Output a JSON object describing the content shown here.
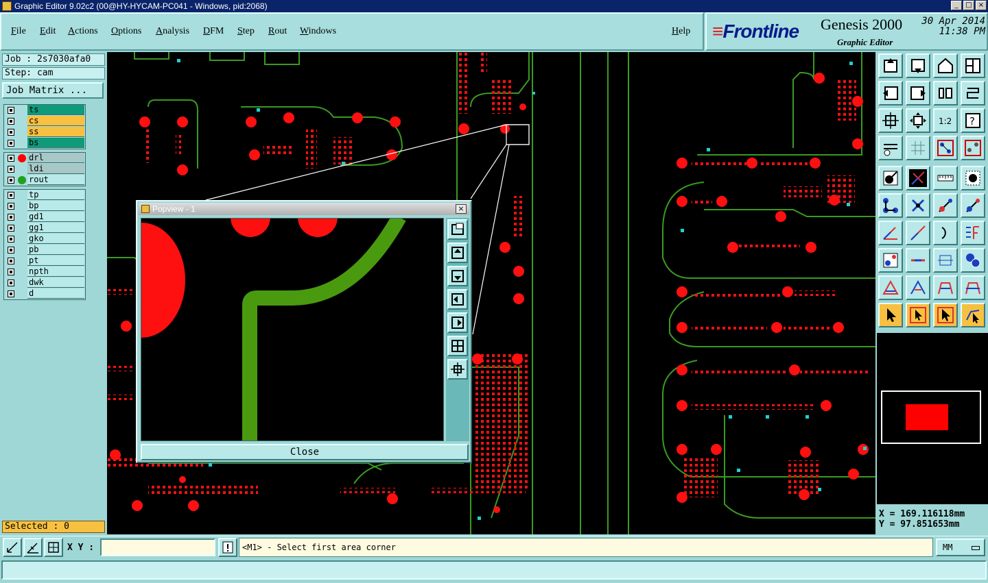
{
  "window": {
    "title": "Graphic Editor 9.02c2 (00@HY-HYCAM-PC041 - Windows, pid:2068)",
    "controls": [
      "_",
      "□",
      "×"
    ]
  },
  "menu": [
    "File",
    "Edit",
    "Actions",
    "Options",
    "Analysis",
    "DFM",
    "Step",
    "Rout",
    "Windows",
    "Help"
  ],
  "brand": {
    "logo": "Frontline",
    "product": "Genesis 2000",
    "subtitle": "Graphic Editor",
    "date": "30 Apr 2014",
    "time": "11:38 PM"
  },
  "job": {
    "job_label": "Job : 2s7030afa0",
    "step_label": "Step: cam",
    "matrix_button": "Job Matrix ..."
  },
  "layers": {
    "group1": [
      {
        "name": "ts",
        "style": "green"
      },
      {
        "name": "cs",
        "style": "orange"
      },
      {
        "name": "ss",
        "style": "orange"
      },
      {
        "name": "bs",
        "style": "green"
      }
    ],
    "group2": [
      {
        "name": "drl",
        "style": "gray",
        "dot": "#ff0000"
      },
      {
        "name": "ldi",
        "style": "gray",
        "dot": ""
      },
      {
        "name": "rout",
        "style": "plain",
        "dot": "#20a020"
      }
    ],
    "group3": [
      {
        "name": "tp"
      },
      {
        "name": "bp"
      },
      {
        "name": "gd1"
      },
      {
        "name": "gg1"
      },
      {
        "name": "gko"
      },
      {
        "name": "pb"
      },
      {
        "name": "pt"
      },
      {
        "name": "npth"
      },
      {
        "name": "dwk"
      },
      {
        "name": "d"
      }
    ]
  },
  "selected": "Selected : 0",
  "coords": {
    "x": "X = 169.116118mm",
    "y": "Y = 97.851653mm"
  },
  "status": {
    "xy_label": "X Y :",
    "xy_value": "",
    "prompt": "<M1> - Select first area corner",
    "units": "MM"
  },
  "popview": {
    "title": "Popview - 1",
    "close_label": "Close"
  },
  "colors": {
    "pad": "#ff0000",
    "trace": "#4a9a10",
    "outline": "#3a8a20",
    "via": "#20d0d0"
  }
}
